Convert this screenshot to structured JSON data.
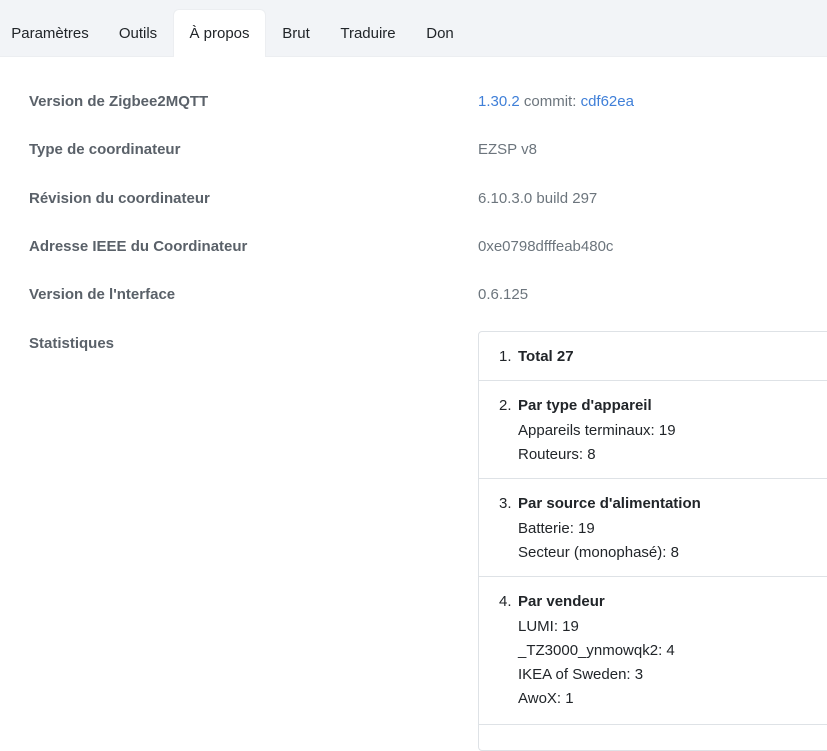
{
  "tabs": [
    {
      "label": "Paramètres"
    },
    {
      "label": "Outils"
    },
    {
      "label": "À propos"
    },
    {
      "label": "Brut"
    },
    {
      "label": "Traduire"
    },
    {
      "label": "Don"
    }
  ],
  "about": {
    "zigbee_version": {
      "label": "Version de Zigbee2MQTT",
      "version": "1.30.2",
      "commit_label": "commit:",
      "commit": "cdf62ea"
    },
    "coordinator_type": {
      "label": "Type de coordinateur",
      "value": "EZSP v8"
    },
    "coordinator_revision": {
      "label": "Révision du coordinateur",
      "value": "6.10.3.0 build 297"
    },
    "coordinator_ieee": {
      "label": "Adresse IEEE du Coordinateur",
      "value": "0xe0798dfffeab480c"
    },
    "interface_version": {
      "label": "Version de l'nterface",
      "value": "0.6.125"
    },
    "stats_label": "Statistiques"
  },
  "stats": [
    {
      "num": "1.",
      "title": "Total 27",
      "lines": []
    },
    {
      "num": "2.",
      "title": "Par type d'appareil",
      "lines": [
        "Appareils terminaux: 19",
        "Routeurs: 8"
      ]
    },
    {
      "num": "3.",
      "title": "Par source d'alimentation",
      "lines": [
        "Batterie: 19",
        "Secteur (monophasé): 8"
      ]
    },
    {
      "num": "4.",
      "title": "Par vendeur",
      "lines": [
        "LUMI: 19",
        "_TZ3000_ynmowqk2: 4",
        "IKEA of Sweden: 3",
        "AwoX: 1"
      ]
    }
  ]
}
